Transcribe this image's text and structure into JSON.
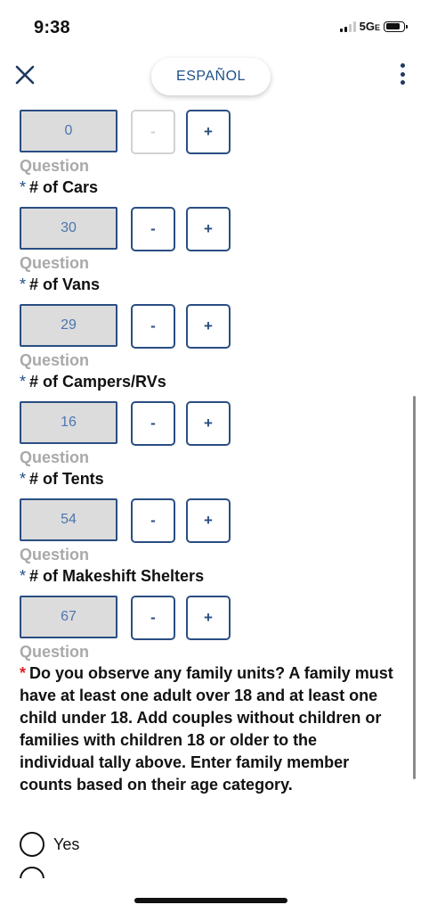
{
  "status_bar": {
    "time": "9:38",
    "network": "5G",
    "network_suffix": "E"
  },
  "header": {
    "close_icon": "close-icon",
    "language_button": "ESPAÑOL",
    "menu_icon": "more-vertical-icon"
  },
  "colors": {
    "accent": "#2a4e82",
    "required_star_blue": "#1e4f86",
    "required_star_red": "#e02424",
    "question_gray": "#a9a9a9",
    "count_box_bg": "#dcdcdc"
  },
  "counters": [
    {
      "value": "0",
      "minus": "-",
      "plus": "+",
      "minus_disabled": true
    },
    {
      "value": "30",
      "minus": "-",
      "plus": "+",
      "minus_disabled": false
    },
    {
      "value": "29",
      "minus": "-",
      "plus": "+",
      "minus_disabled": false
    },
    {
      "value": "16",
      "minus": "-",
      "plus": "+",
      "minus_disabled": false
    },
    {
      "value": "54",
      "minus": "-",
      "plus": "+",
      "minus_disabled": false
    },
    {
      "value": "67",
      "minus": "-",
      "plus": "+",
      "minus_disabled": false
    }
  ],
  "questions": [
    {
      "label": "Question",
      "star": "*",
      "title": "# of Cars"
    },
    {
      "label": "Question",
      "star": "*",
      "title": "# of Vans"
    },
    {
      "label": "Question",
      "star": "*",
      "title": "# of Campers/RVs"
    },
    {
      "label": "Question",
      "star": "*",
      "title": "# of Tents"
    },
    {
      "label": "Question",
      "star": "*",
      "title": "# of Makeshift Shelters"
    }
  ],
  "family_question": {
    "label": "Question",
    "star": "*",
    "text": "Do you observe any family units? A family must have at least one adult over 18 and at least one child under 18. Add couples without children or families with children 18 or older to the individual tally above. Enter family member counts based on their age category.",
    "options": [
      "Yes"
    ]
  }
}
